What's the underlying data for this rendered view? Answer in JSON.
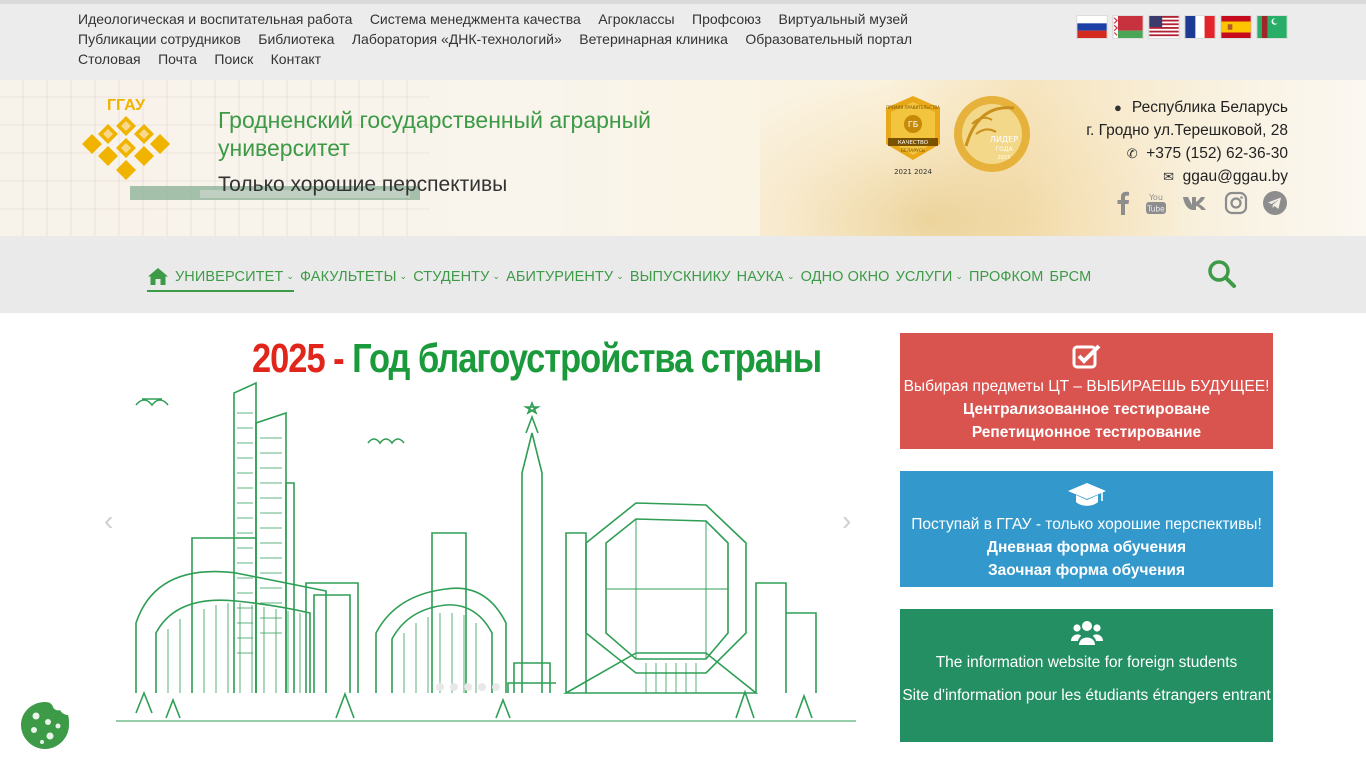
{
  "top_links": {
    "row1": [
      "Идеологическая и воспитательная работа",
      "Система менеджмента качества",
      "Агроклассы",
      "Профсоюз",
      "Виртуальный музей"
    ],
    "row2": [
      "Публикации сотрудников",
      "Библиотека",
      "Лаборатория «ДНК-технологий»",
      "Ветеринарная клиника",
      "Образовательный портал"
    ],
    "row3": [
      "Столовая",
      "Почта",
      "Поиск",
      "Контакт"
    ]
  },
  "flags": [
    "russian-flag",
    "belarusian-flag",
    "us-flag",
    "french-flag",
    "spanish-flag",
    "turkmen-flag"
  ],
  "header": {
    "logo_text": "ГГАУ",
    "title": "Гродненский государственный аграрный университет",
    "slogan": "Только хорошие перспективы",
    "award1": {
      "top": "ПРЕМИЯ ПРАВИТЕЛЬСТВА",
      "middle": "КАЧЕСТВО",
      "bottom": "БЕЛАРУСЬ",
      "years": "2021  2024"
    },
    "award2": {
      "line1": "ЛИДЕР",
      "line2": "ГОДА",
      "year": "2023"
    }
  },
  "contacts": {
    "country": "Республика Беларусь",
    "address": "г. Гродно ул.Терешковой, 28",
    "phone": "+375 (152) 62-36-30",
    "email": "ggau@ggau.by"
  },
  "social": [
    "facebook-icon",
    "youtube-icon",
    "vk-icon",
    "instagram-icon",
    "telegram-icon"
  ],
  "menu": [
    {
      "label": "Университет",
      "dropdown": true
    },
    {
      "label": "Факультеты",
      "dropdown": true
    },
    {
      "label": "Студенту",
      "dropdown": true
    },
    {
      "label": "Абитуриенту",
      "dropdown": true
    },
    {
      "label": "Выпускнику",
      "dropdown": false
    },
    {
      "label": "Наука",
      "dropdown": true
    },
    {
      "label": "Одно окно",
      "dropdown": false
    },
    {
      "label": "Услуги",
      "dropdown": true
    },
    {
      "label": "Профком",
      "dropdown": false
    },
    {
      "label": "БРСМ",
      "dropdown": false
    }
  ],
  "slider": {
    "year": "2025",
    "dash": " - ",
    "title": "Год благоустройства страны"
  },
  "cards": {
    "ct": {
      "headline": "Выбирая предметы ЦТ – ВЫБИРАЕШЬ БУДУЩЕЕ!",
      "link1": "Централизованное тестироване",
      "link2": "Репетиционное тестирование"
    },
    "admission": {
      "headline": "Поступай в ГГАУ - только хорошие перспективы!",
      "link1": "Дневная форма обучения",
      "link2": "Заочная форма обучения"
    },
    "foreign": {
      "link1": "The information website for foreign students",
      "link2": "Site d'information pour les étudiants étrangers entrant"
    }
  },
  "colors": {
    "brand_green": "#3d9a47",
    "card_red": "#d9534f",
    "card_blue": "#3399cc",
    "card_green": "#238f63"
  }
}
